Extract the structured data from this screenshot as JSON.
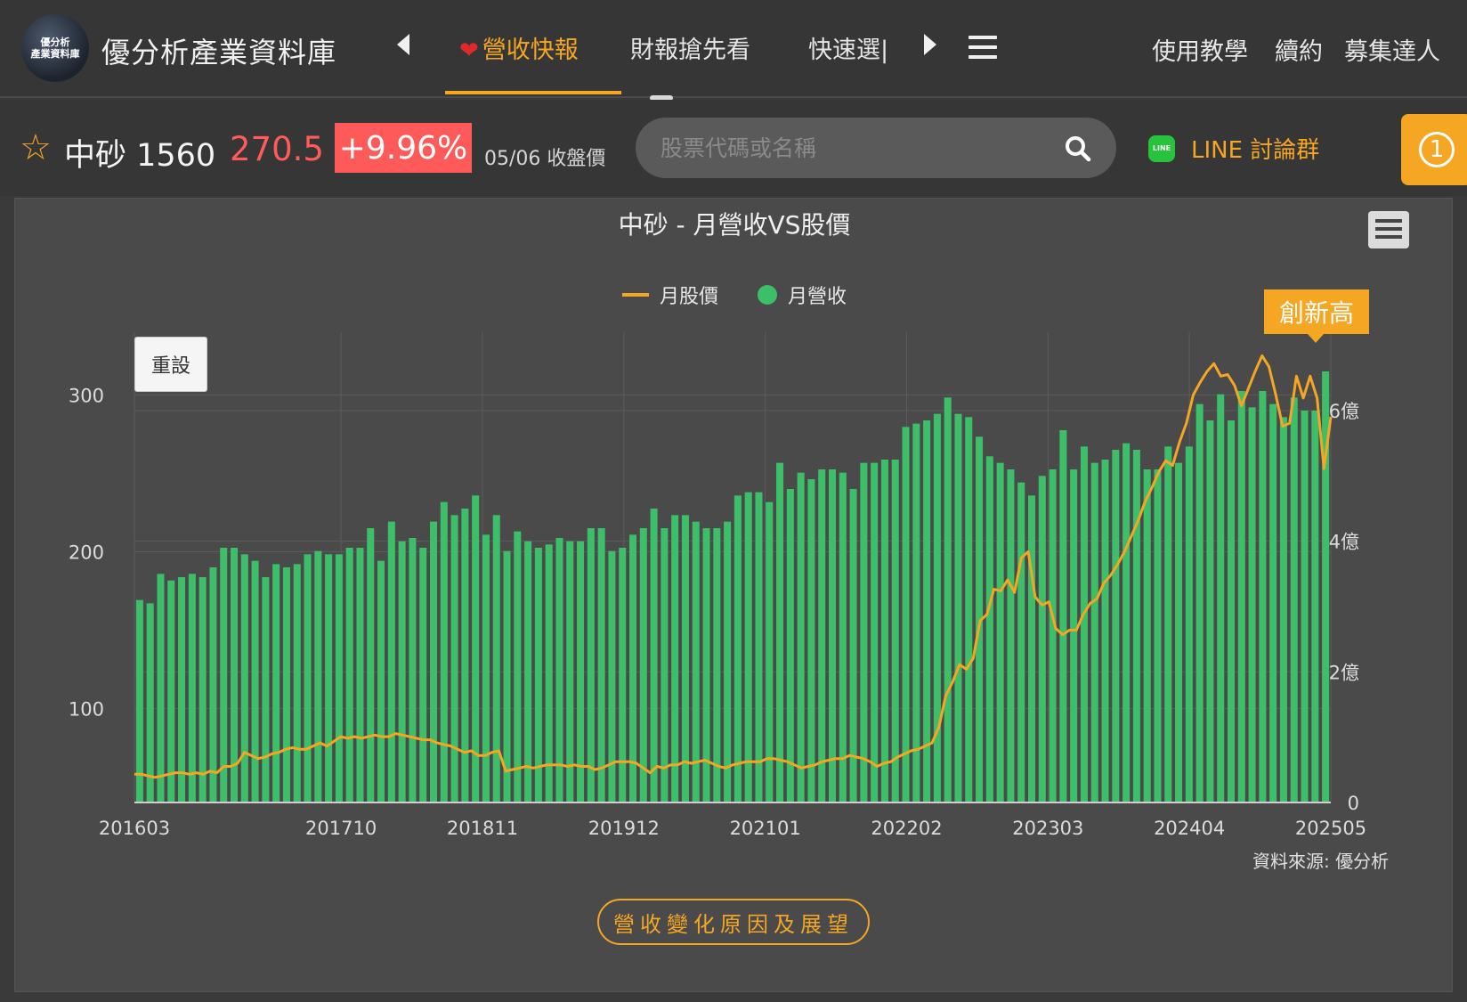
{
  "nav": {
    "logo_line1": "優分析",
    "logo_line2": "產業資料庫",
    "site_title": "優分析產業資料庫",
    "tabs": [
      {
        "label": "營收快報",
        "active": true
      },
      {
        "label": "財報搶先看",
        "active": false
      },
      {
        "label": "快速選|",
        "active": false
      }
    ],
    "right_links": [
      "使用教學",
      "續約",
      "募集達人"
    ]
  },
  "stock": {
    "name": "中砂 1560",
    "price": "270.5",
    "change": "+9.96%",
    "close_label": "05/06 收盤價",
    "search_placeholder": "股票代碼或名稱",
    "line_icon_text": "LINE",
    "line_label": "LINE 討論群",
    "badge": "1"
  },
  "chart": {
    "title": "中砂 - 月營收VS股價",
    "legend_price": "月股價",
    "legend_revenue": "月營收",
    "reset_label": "重設",
    "new_high_label": "創新高",
    "source": "資料來源: 優分析",
    "reason_button": "營收變化原因及展望"
  },
  "colors": {
    "accent": "#f5a623",
    "bar": "#3dbf6a",
    "price_up": "#ff5a5a",
    "panel_bg": "#4a4a4a"
  },
  "chart_data": {
    "type": "bar",
    "title": "中砂 - 月營收VS股價",
    "x_start": "201603",
    "x_end": "202505",
    "x_ticks": [
      "201603",
      "201710",
      "201811",
      "201912",
      "202101",
      "202202",
      "202303",
      "202404",
      "202505"
    ],
    "left_axis": {
      "ticks": [
        "100",
        "200",
        "300"
      ],
      "range": [
        40,
        340
      ]
    },
    "right_axis": {
      "ticks": [
        "0",
        "2億",
        "4億",
        "6億"
      ],
      "range": [
        0,
        7.2
      ],
      "unit": "億"
    },
    "series": [
      {
        "name": "月營收",
        "type": "bar",
        "axis": "right",
        "values": [
          3.1,
          3.05,
          3.5,
          3.4,
          3.45,
          3.5,
          3.45,
          3.6,
          3.9,
          3.9,
          3.8,
          3.7,
          3.45,
          3.65,
          3.6,
          3.65,
          3.8,
          3.85,
          3.8,
          3.8,
          3.9,
          3.9,
          4.2,
          3.7,
          4.3,
          4.0,
          4.05,
          3.9,
          4.3,
          4.6,
          4.4,
          4.5,
          4.7,
          4.1,
          4.4,
          3.85,
          4.15,
          4.0,
          3.9,
          3.95,
          4.05,
          4.0,
          4.0,
          4.2,
          4.2,
          3.85,
          3.9,
          4.1,
          4.2,
          4.5,
          4.2,
          4.4,
          4.4,
          4.3,
          4.2,
          4.2,
          4.3,
          4.7,
          4.75,
          4.75,
          4.6,
          5.2,
          4.8,
          5.05,
          4.95,
          5.1,
          5.1,
          5.05,
          4.8,
          5.2,
          5.2,
          5.25,
          5.25,
          5.75,
          5.8,
          5.85,
          5.95,
          6.2,
          5.95,
          5.9,
          5.6,
          5.3,
          5.2,
          5.1,
          4.9,
          4.7,
          5.0,
          5.1,
          5.7,
          5.1,
          5.45,
          5.2,
          5.25,
          5.4,
          5.5,
          5.4,
          5.1,
          5.1,
          5.45,
          5.2,
          5.45,
          6.1,
          5.85,
          6.25,
          5.85,
          6.3,
          6.05,
          6.3,
          6.1,
          5.9,
          6.2,
          6.0,
          6.0,
          6.6
        ]
      },
      {
        "name": "月股價",
        "type": "line",
        "axis": "left",
        "values": [
          58,
          58,
          57,
          56,
          57,
          58,
          59,
          59,
          58,
          59,
          58,
          60,
          59,
          63,
          63,
          65,
          72,
          70,
          68,
          69,
          71,
          72,
          74,
          75,
          74,
          74,
          76,
          78,
          76,
          79,
          82,
          81,
          82,
          81,
          82,
          83,
          82,
          82,
          84,
          83,
          82,
          81,
          80,
          80,
          78,
          77,
          76,
          74,
          72,
          73,
          70,
          70,
          72,
          73,
          60,
          61,
          62,
          63,
          62,
          63,
          64,
          64,
          64,
          63,
          64,
          63,
          63,
          61,
          62,
          64,
          66,
          66,
          66,
          65,
          62,
          59,
          63,
          62,
          64,
          64,
          66,
          65,
          66,
          67,
          65,
          63,
          62,
          64,
          65,
          66,
          66,
          66,
          68,
          68,
          67,
          66,
          64,
          62,
          63,
          64,
          66,
          67,
          68,
          68,
          70,
          69,
          68,
          66,
          63,
          65,
          66,
          69,
          71,
          73,
          74,
          76,
          78,
          88,
          108,
          117,
          128,
          125,
          132,
          156,
          160,
          176,
          175,
          182,
          174,
          196,
          200,
          171,
          166,
          168,
          151,
          147,
          150,
          150,
          160,
          167,
          170,
          180,
          185,
          192,
          200,
          210,
          220,
          232,
          241,
          251,
          258,
          255,
          270,
          282,
          300,
          308,
          315,
          320,
          312,
          313,
          306,
          293,
          304,
          315,
          325,
          318,
          300,
          280,
          282,
          312,
          298,
          312,
          298,
          253,
          286
        ]
      }
    ]
  }
}
